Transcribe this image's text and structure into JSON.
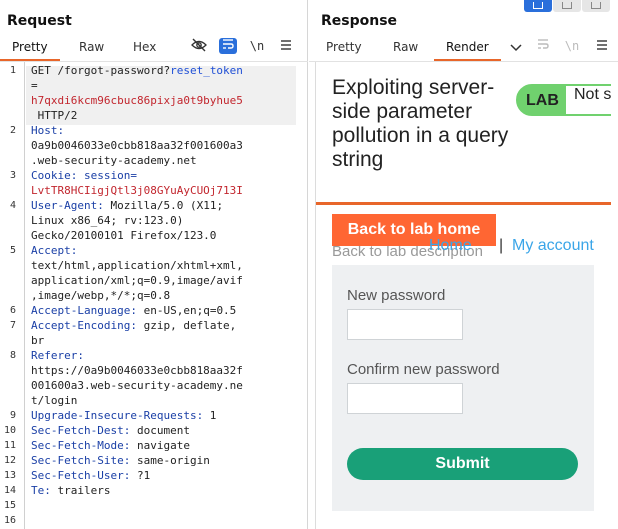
{
  "request": {
    "title": "Request",
    "tabs": [
      "Pretty",
      "Raw",
      "Hex"
    ],
    "tools": {
      "hide_icon": "eye-slash-icon",
      "wrap_icon": "wrap-icon",
      "newline": "\\n",
      "menu_icon": "menu-icon"
    },
    "line_numbers": [
      "1",
      "2",
      "3",
      "4",
      "5",
      "6",
      "7",
      "8",
      "9",
      "10",
      "11",
      "12",
      "13",
      "14",
      "15",
      "16"
    ],
    "lines": {
      "l1a": "GET /forgot-password?",
      "l1b": "reset_token",
      "l1c": "=",
      "l1d": "h7qxdi6kcm96cbuc86pixja0t9byhue5",
      "l1e": " HTTP/2",
      "l2k": "Host:",
      "l2v": "0a9b0046033e0cbb818aa32f001600a3",
      "l2w": ".web-security-academy.net",
      "l3k": "Cookie: session=",
      "l3v": "LvtTR8HCIigjQtl3j08GYuAyCUOj713I",
      "l4k": "User-Agent:",
      "l4v": " Mozilla/5.0 (X11;",
      "l4w": "Linux x86_64; rv:123.0)",
      "l4x": "Gecko/20100101 Firefox/123.0",
      "l5k": "Accept:",
      "l5v": "text/html,application/xhtml+xml,",
      "l5w": "application/xml;q=0.9,image/avif",
      "l5x": ",image/webp,*/*;q=0.8",
      "l6k": "Accept-Language:",
      "l6v": " en-US,en;q=0.5",
      "l7k": "Accept-Encoding:",
      "l7v": " gzip, deflate,",
      "l7w": "br",
      "l8k": "Referer:",
      "l8v": "https://0a9b0046033e0cbb818aa32f",
      "l8w": "001600a3.web-security-academy.ne",
      "l8x": "t/login",
      "l9k": "Upgrade-Insecure-Requests:",
      "l9v": " 1",
      "l10k": "Sec-Fetch-Dest:",
      "l10v": " document",
      "l11k": "Sec-Fetch-Mode:",
      "l11v": " navigate",
      "l12k": "Sec-Fetch-Site:",
      "l12v": " same-origin",
      "l13k": "Sec-Fetch-User:",
      "l13v": " ?1",
      "l14k": "Te:",
      "l14v": " trailers"
    }
  },
  "response": {
    "title": "Response",
    "tabs": [
      "Pretty",
      "Raw",
      "Render"
    ],
    "active_tab": "Render",
    "tools": {
      "dropdown_icon": "chevron-down-icon",
      "wrap_icon": "wrap-icon",
      "newline": "\\n",
      "menu_icon": "menu-icon"
    },
    "render": {
      "lab_title": "Exploiting server-side parameter pollution in a query string",
      "lab_badge": "LAB",
      "lab_status": "Not s",
      "back_button": "Back to lab home",
      "back_description": "Back to lab description",
      "chevron": "»",
      "nav_home": "Home",
      "nav_separator": "|",
      "nav_account": "My account",
      "new_password_label": "New password",
      "confirm_password_label": "Confirm new password",
      "submit": "Submit"
    }
  },
  "colors": {
    "accent": "#e8662a",
    "lab_green": "#70d16e",
    "submit_green": "#19a078",
    "link_blue": "#3aa5e8",
    "toolbar_blue": "#2a6fdb"
  }
}
